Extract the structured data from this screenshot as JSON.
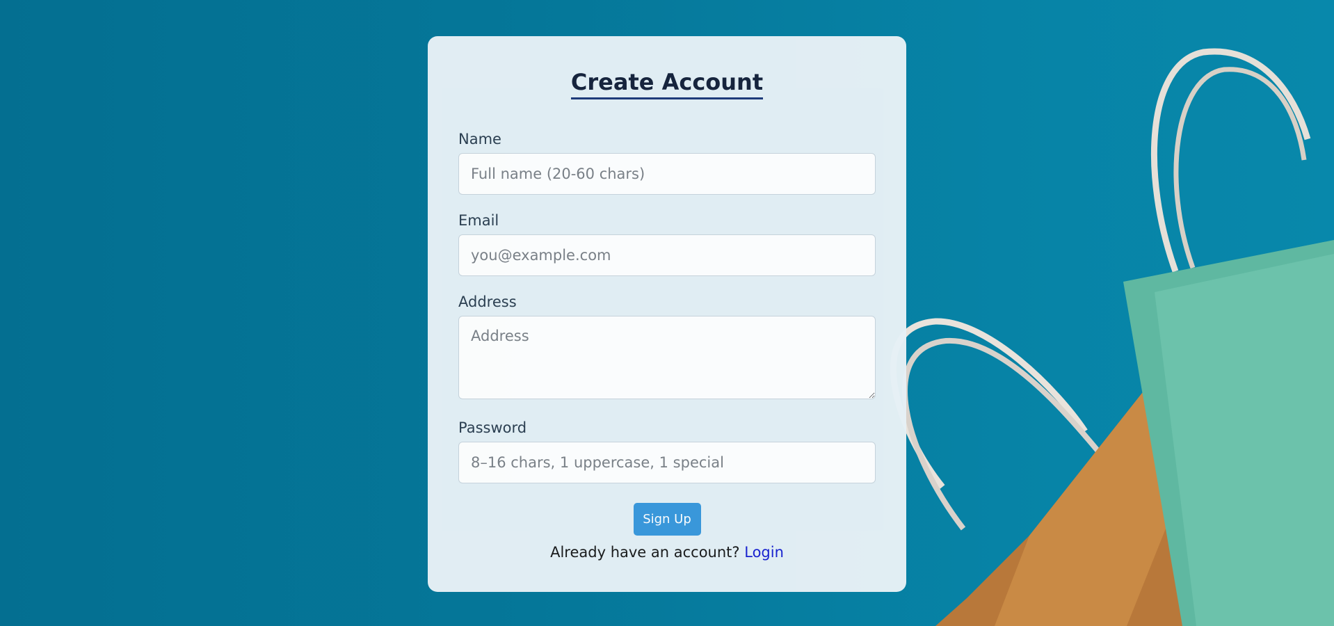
{
  "form": {
    "title": "Create Account",
    "fields": [
      {
        "label": "Name",
        "placeholder": "Full name (20-60 chars)",
        "value": ""
      },
      {
        "label": "Email",
        "placeholder": "you@example.com",
        "value": ""
      },
      {
        "label": "Address",
        "placeholder": "Address",
        "value": ""
      },
      {
        "label": "Password",
        "placeholder": "8–16 chars, 1 uppercase, 1 special",
        "value": ""
      }
    ],
    "submit_label": "Sign Up",
    "login_prompt": "Already have an account?",
    "login_link": "Login"
  },
  "colors": {
    "background": "#057799",
    "card": "#e5f0f5",
    "button": "#3b98dc",
    "link": "#1a22d0"
  },
  "background_image": "shopping-bags"
}
